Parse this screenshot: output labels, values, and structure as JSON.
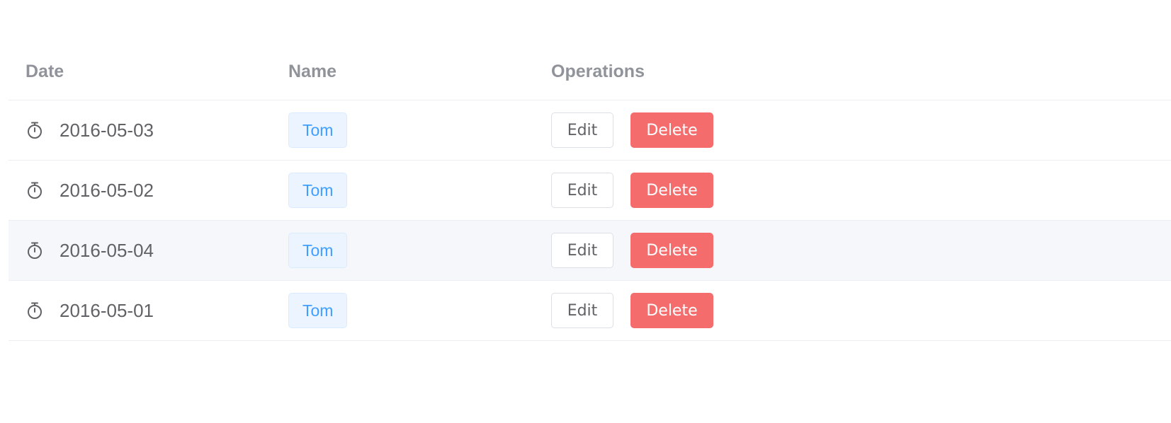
{
  "table": {
    "columns": [
      "Date",
      "Name",
      "Operations"
    ],
    "rows": [
      {
        "date": "2016-05-03",
        "name": "Tom",
        "edit_label": "Edit",
        "delete_label": "Delete",
        "hover": false
      },
      {
        "date": "2016-05-02",
        "name": "Tom",
        "edit_label": "Edit",
        "delete_label": "Delete",
        "hover": false
      },
      {
        "date": "2016-05-04",
        "name": "Tom",
        "edit_label": "Edit",
        "delete_label": "Delete",
        "hover": true
      },
      {
        "date": "2016-05-01",
        "name": "Tom",
        "edit_label": "Edit",
        "delete_label": "Delete",
        "hover": false
      }
    ],
    "date_icon": "timer-icon"
  },
  "colors": {
    "header_text": "#909399",
    "body_text": "#606266",
    "tag_text": "#409eff",
    "tag_bg": "#ecf5ff",
    "danger": "#f56c6c",
    "hover_row_bg": "#f5f7fa",
    "border": "#ebeef5"
  }
}
